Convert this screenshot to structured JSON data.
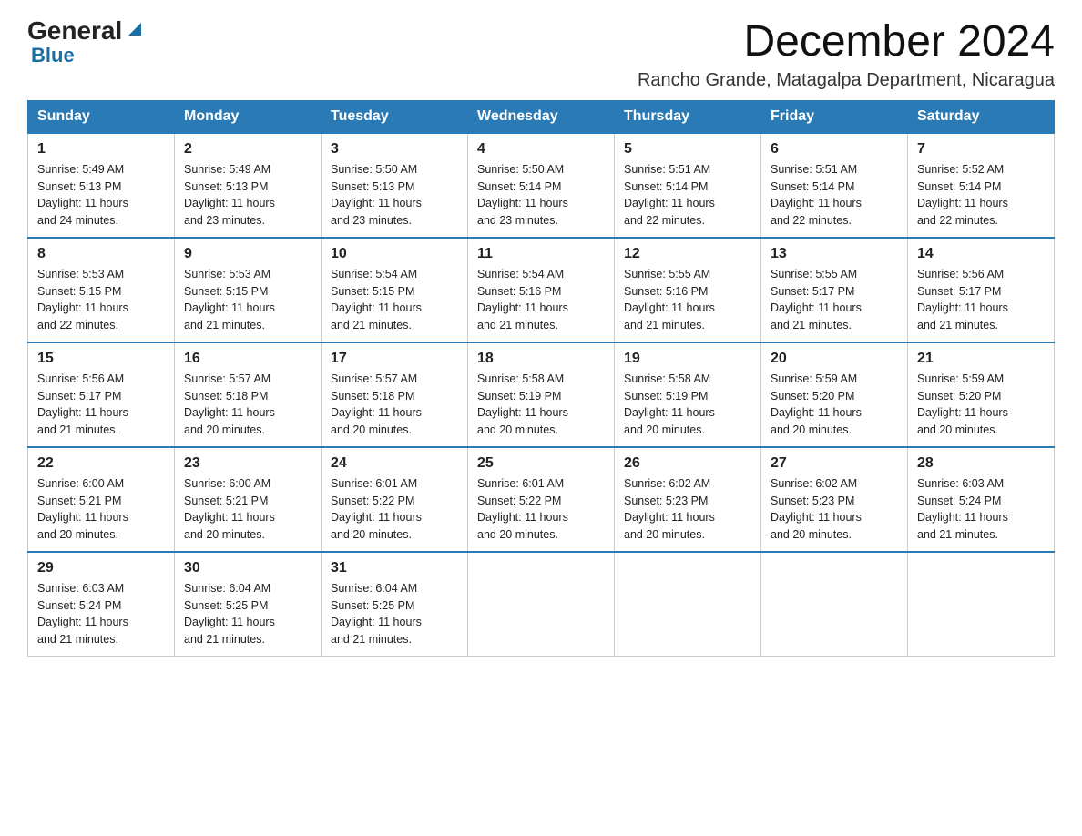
{
  "header": {
    "logo_general": "General",
    "logo_blue": "Blue",
    "main_title": "December 2024",
    "subtitle": "Rancho Grande, Matagalpa Department, Nicaragua"
  },
  "weekdays": [
    "Sunday",
    "Monday",
    "Tuesday",
    "Wednesday",
    "Thursday",
    "Friday",
    "Saturday"
  ],
  "weeks": [
    [
      {
        "day": 1,
        "sunrise": "5:49 AM",
        "sunset": "5:13 PM",
        "daylight": "11 hours and 24 minutes."
      },
      {
        "day": 2,
        "sunrise": "5:49 AM",
        "sunset": "5:13 PM",
        "daylight": "11 hours and 23 minutes."
      },
      {
        "day": 3,
        "sunrise": "5:50 AM",
        "sunset": "5:13 PM",
        "daylight": "11 hours and 23 minutes."
      },
      {
        "day": 4,
        "sunrise": "5:50 AM",
        "sunset": "5:14 PM",
        "daylight": "11 hours and 23 minutes."
      },
      {
        "day": 5,
        "sunrise": "5:51 AM",
        "sunset": "5:14 PM",
        "daylight": "11 hours and 22 minutes."
      },
      {
        "day": 6,
        "sunrise": "5:51 AM",
        "sunset": "5:14 PM",
        "daylight": "11 hours and 22 minutes."
      },
      {
        "day": 7,
        "sunrise": "5:52 AM",
        "sunset": "5:14 PM",
        "daylight": "11 hours and 22 minutes."
      }
    ],
    [
      {
        "day": 8,
        "sunrise": "5:53 AM",
        "sunset": "5:15 PM",
        "daylight": "11 hours and 22 minutes."
      },
      {
        "day": 9,
        "sunrise": "5:53 AM",
        "sunset": "5:15 PM",
        "daylight": "11 hours and 21 minutes."
      },
      {
        "day": 10,
        "sunrise": "5:54 AM",
        "sunset": "5:15 PM",
        "daylight": "11 hours and 21 minutes."
      },
      {
        "day": 11,
        "sunrise": "5:54 AM",
        "sunset": "5:16 PM",
        "daylight": "11 hours and 21 minutes."
      },
      {
        "day": 12,
        "sunrise": "5:55 AM",
        "sunset": "5:16 PM",
        "daylight": "11 hours and 21 minutes."
      },
      {
        "day": 13,
        "sunrise": "5:55 AM",
        "sunset": "5:17 PM",
        "daylight": "11 hours and 21 minutes."
      },
      {
        "day": 14,
        "sunrise": "5:56 AM",
        "sunset": "5:17 PM",
        "daylight": "11 hours and 21 minutes."
      }
    ],
    [
      {
        "day": 15,
        "sunrise": "5:56 AM",
        "sunset": "5:17 PM",
        "daylight": "11 hours and 21 minutes."
      },
      {
        "day": 16,
        "sunrise": "5:57 AM",
        "sunset": "5:18 PM",
        "daylight": "11 hours and 20 minutes."
      },
      {
        "day": 17,
        "sunrise": "5:57 AM",
        "sunset": "5:18 PM",
        "daylight": "11 hours and 20 minutes."
      },
      {
        "day": 18,
        "sunrise": "5:58 AM",
        "sunset": "5:19 PM",
        "daylight": "11 hours and 20 minutes."
      },
      {
        "day": 19,
        "sunrise": "5:58 AM",
        "sunset": "5:19 PM",
        "daylight": "11 hours and 20 minutes."
      },
      {
        "day": 20,
        "sunrise": "5:59 AM",
        "sunset": "5:20 PM",
        "daylight": "11 hours and 20 minutes."
      },
      {
        "day": 21,
        "sunrise": "5:59 AM",
        "sunset": "5:20 PM",
        "daylight": "11 hours and 20 minutes."
      }
    ],
    [
      {
        "day": 22,
        "sunrise": "6:00 AM",
        "sunset": "5:21 PM",
        "daylight": "11 hours and 20 minutes."
      },
      {
        "day": 23,
        "sunrise": "6:00 AM",
        "sunset": "5:21 PM",
        "daylight": "11 hours and 20 minutes."
      },
      {
        "day": 24,
        "sunrise": "6:01 AM",
        "sunset": "5:22 PM",
        "daylight": "11 hours and 20 minutes."
      },
      {
        "day": 25,
        "sunrise": "6:01 AM",
        "sunset": "5:22 PM",
        "daylight": "11 hours and 20 minutes."
      },
      {
        "day": 26,
        "sunrise": "6:02 AM",
        "sunset": "5:23 PM",
        "daylight": "11 hours and 20 minutes."
      },
      {
        "day": 27,
        "sunrise": "6:02 AM",
        "sunset": "5:23 PM",
        "daylight": "11 hours and 20 minutes."
      },
      {
        "day": 28,
        "sunrise": "6:03 AM",
        "sunset": "5:24 PM",
        "daylight": "11 hours and 21 minutes."
      }
    ],
    [
      {
        "day": 29,
        "sunrise": "6:03 AM",
        "sunset": "5:24 PM",
        "daylight": "11 hours and 21 minutes."
      },
      {
        "day": 30,
        "sunrise": "6:04 AM",
        "sunset": "5:25 PM",
        "daylight": "11 hours and 21 minutes."
      },
      {
        "day": 31,
        "sunrise": "6:04 AM",
        "sunset": "5:25 PM",
        "daylight": "11 hours and 21 minutes."
      },
      null,
      null,
      null,
      null
    ]
  ],
  "labels": {
    "sunrise": "Sunrise:",
    "sunset": "Sunset:",
    "daylight": "Daylight:"
  }
}
